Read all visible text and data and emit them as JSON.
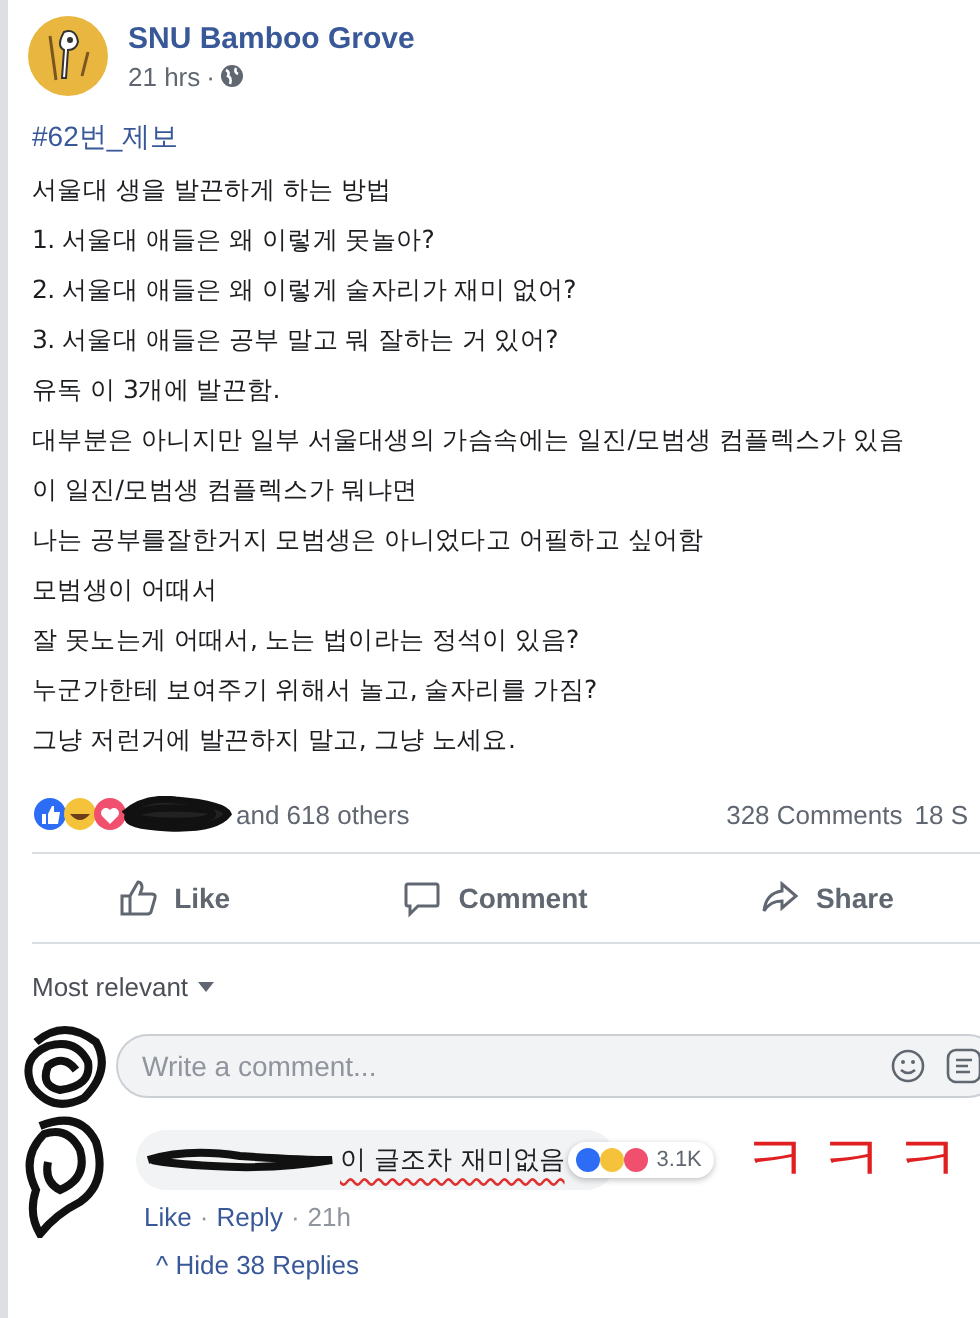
{
  "post": {
    "author": "SNU Bamboo Grove",
    "time": "21 hrs",
    "time_separator": "·",
    "hashtag": "#62번_제보",
    "lines": [
      "서울대 생을 발끈하게 하는 방법",
      "1. 서울대 애들은 왜 이렇게 못놀아?",
      "2. 서울대 애들은 왜 이렇게 술자리가 재미 없어?",
      "3. 서울대 애들은 공부 말고 뭐 잘하는 거 있어?",
      "유독 이 3개에 발끈함.",
      "대부분은 아니지만 일부 서울대생의 가슴속에는 일진/모범생 컴플렉스가 있음",
      "이 일진/모범생 컴플렉스가 뭐냐면",
      "나는 공부를잘한거지 모범생은 아니었다고 어필하고 싶어함",
      "모범생이 어때서",
      "잘 못노는게 어때서, 노는 법이라는 정석이 있음?",
      "누군가한테 보여주기 위해서 놀고, 술자리를 가짐?",
      "그냥 저런거에 발끈하지 말고, 그냥 노세요."
    ]
  },
  "reactions": {
    "others": "and 618 others",
    "comments": "328 Comments",
    "shares": "18 S"
  },
  "actions": [
    {
      "kind": "like",
      "label": "Like"
    },
    {
      "kind": "comment",
      "label": "Comment"
    },
    {
      "kind": "share",
      "label": "Share"
    }
  ],
  "sort": "Most relevant",
  "composer": {
    "placeholder": "Write a comment..."
  },
  "comment": {
    "text": "이 글조차 재미없음",
    "reaction_count": "3.1K",
    "links": [
      "Like",
      "Reply"
    ],
    "separator": "·",
    "time": "21h"
  },
  "annotation": "ㅋㅋㅋ",
  "replies_toggle": {
    "icon": "^",
    "label": "Hide 38 Replies"
  }
}
